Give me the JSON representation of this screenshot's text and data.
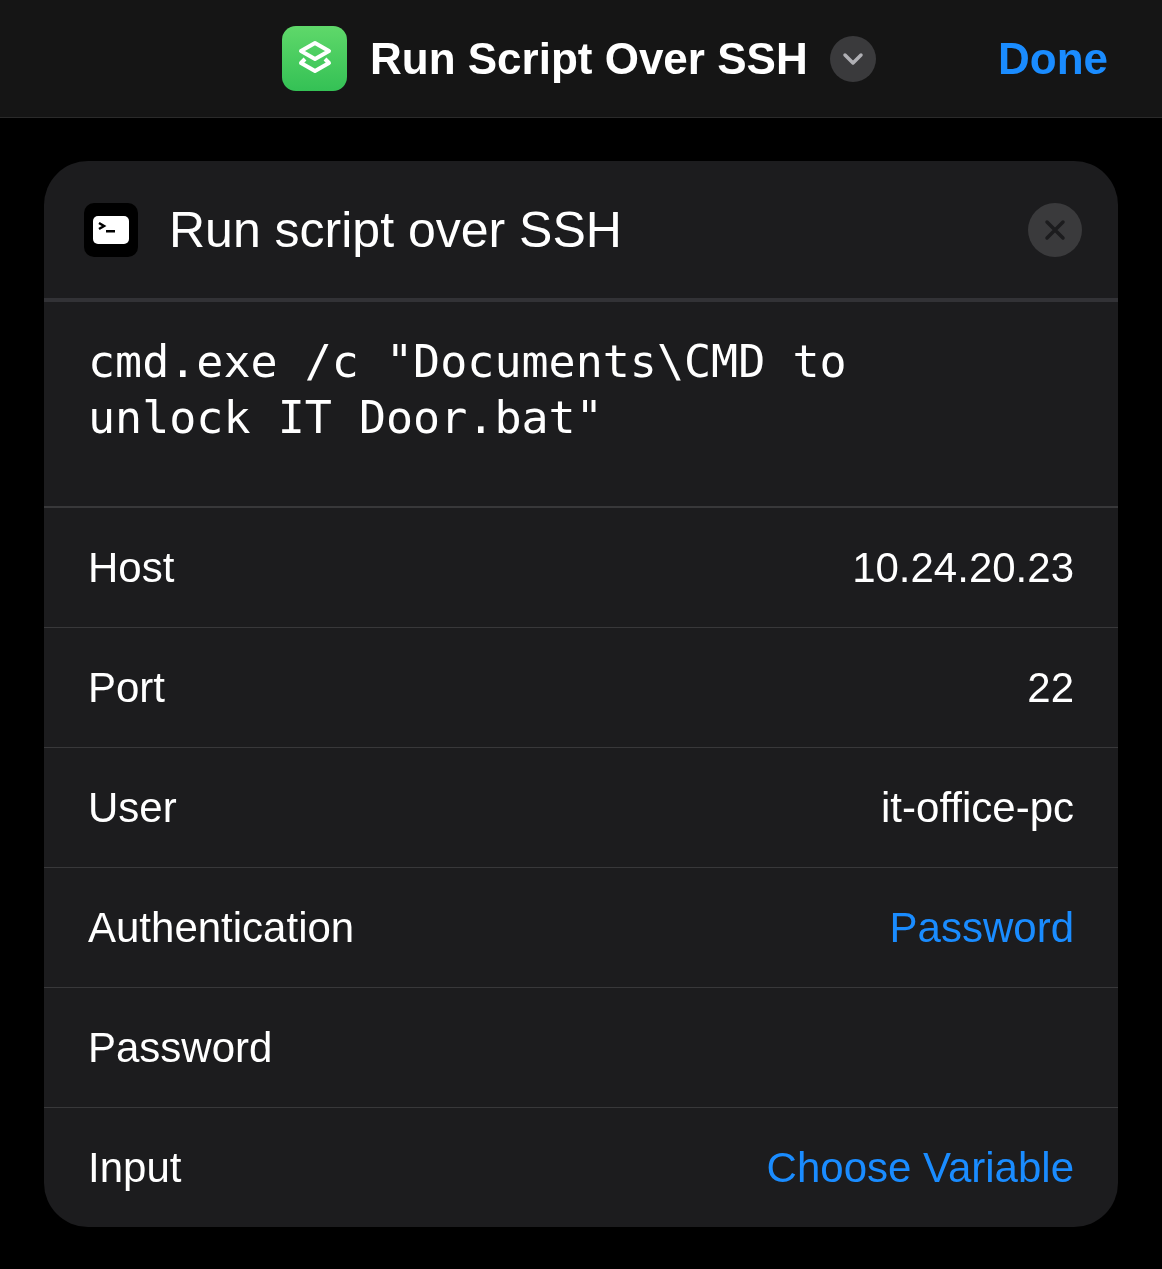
{
  "nav": {
    "title": "Run Script Over SSH",
    "done": "Done"
  },
  "action": {
    "title": "Run script over SSH",
    "script": "cmd.exe /c \"Documents\\CMD to unlock IT Door.bat\"",
    "rows": [
      {
        "label": "Host",
        "value": "10.24.20.23",
        "kind": "text"
      },
      {
        "label": "Port",
        "value": "22",
        "kind": "text"
      },
      {
        "label": "User",
        "value": "it-office-pc",
        "kind": "text"
      },
      {
        "label": "Authentication",
        "value": "Password",
        "kind": "link"
      },
      {
        "label": "Password",
        "kind": "empty"
      },
      {
        "label": "Input",
        "value": "Choose Variable",
        "kind": "link"
      }
    ]
  }
}
